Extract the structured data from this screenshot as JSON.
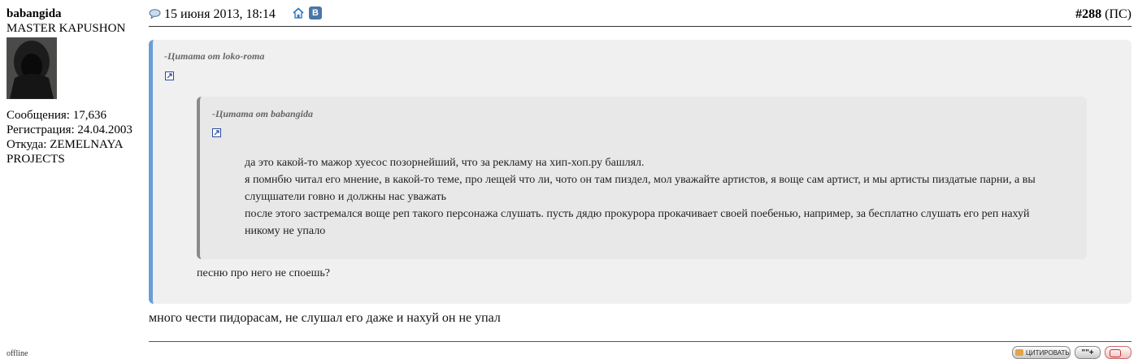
{
  "user": {
    "username": "babangida",
    "title": "MASTER KAPUSHON",
    "stats": [
      "Сообщения: 17,636",
      "Регистрация: 24.04.2003",
      "Откуда: ZEMELNAYA PROJECTS"
    ],
    "status": "offline"
  },
  "post": {
    "date": "15 июня 2013, 18:14",
    "number": "#288",
    "number_suffix": "(ПС)",
    "icons": [
      "post-icon",
      "home-icon",
      "vk-icon"
    ],
    "vk_label": "В",
    "quote_outer": {
      "title": "-Цитата от loko-roma",
      "reply": "песню про него не споешь?"
    },
    "quote_inner": {
      "title": "-Цитата от babangida",
      "lines": [
        "да это какой-то мажор хуесос позорнейший, что за рекламу на хип-хоп.ру башлял.",
        "я помнбю читал его мнение, в какой-то теме, про лещей что ли, чото он там пиздел, мол уважайте артистов, я воще сам артист, и мы артисты пиздатые парни, а вы слущшатели говно и должны нас уважать",
        "после этого застремался воще реп такого персонажа слушать. пусть дядю прокурора прокачивает своей поебенью, например, за бесплатно слушать его реп нахуй никому не упало"
      ]
    },
    "message": "много чести пидорасам, не слушал его даже и нахуй он не упал"
  },
  "buttons": {
    "quote": "ЦИТИРОВАТЬ",
    "multiquote": "\"\"+",
    "report": ""
  },
  "colors": {
    "outer_quote_border": "#6a9cd8",
    "inner_quote_border": "#8a8a8a",
    "quote_background": "#f0f0f0",
    "vk": "#4a76a8"
  }
}
